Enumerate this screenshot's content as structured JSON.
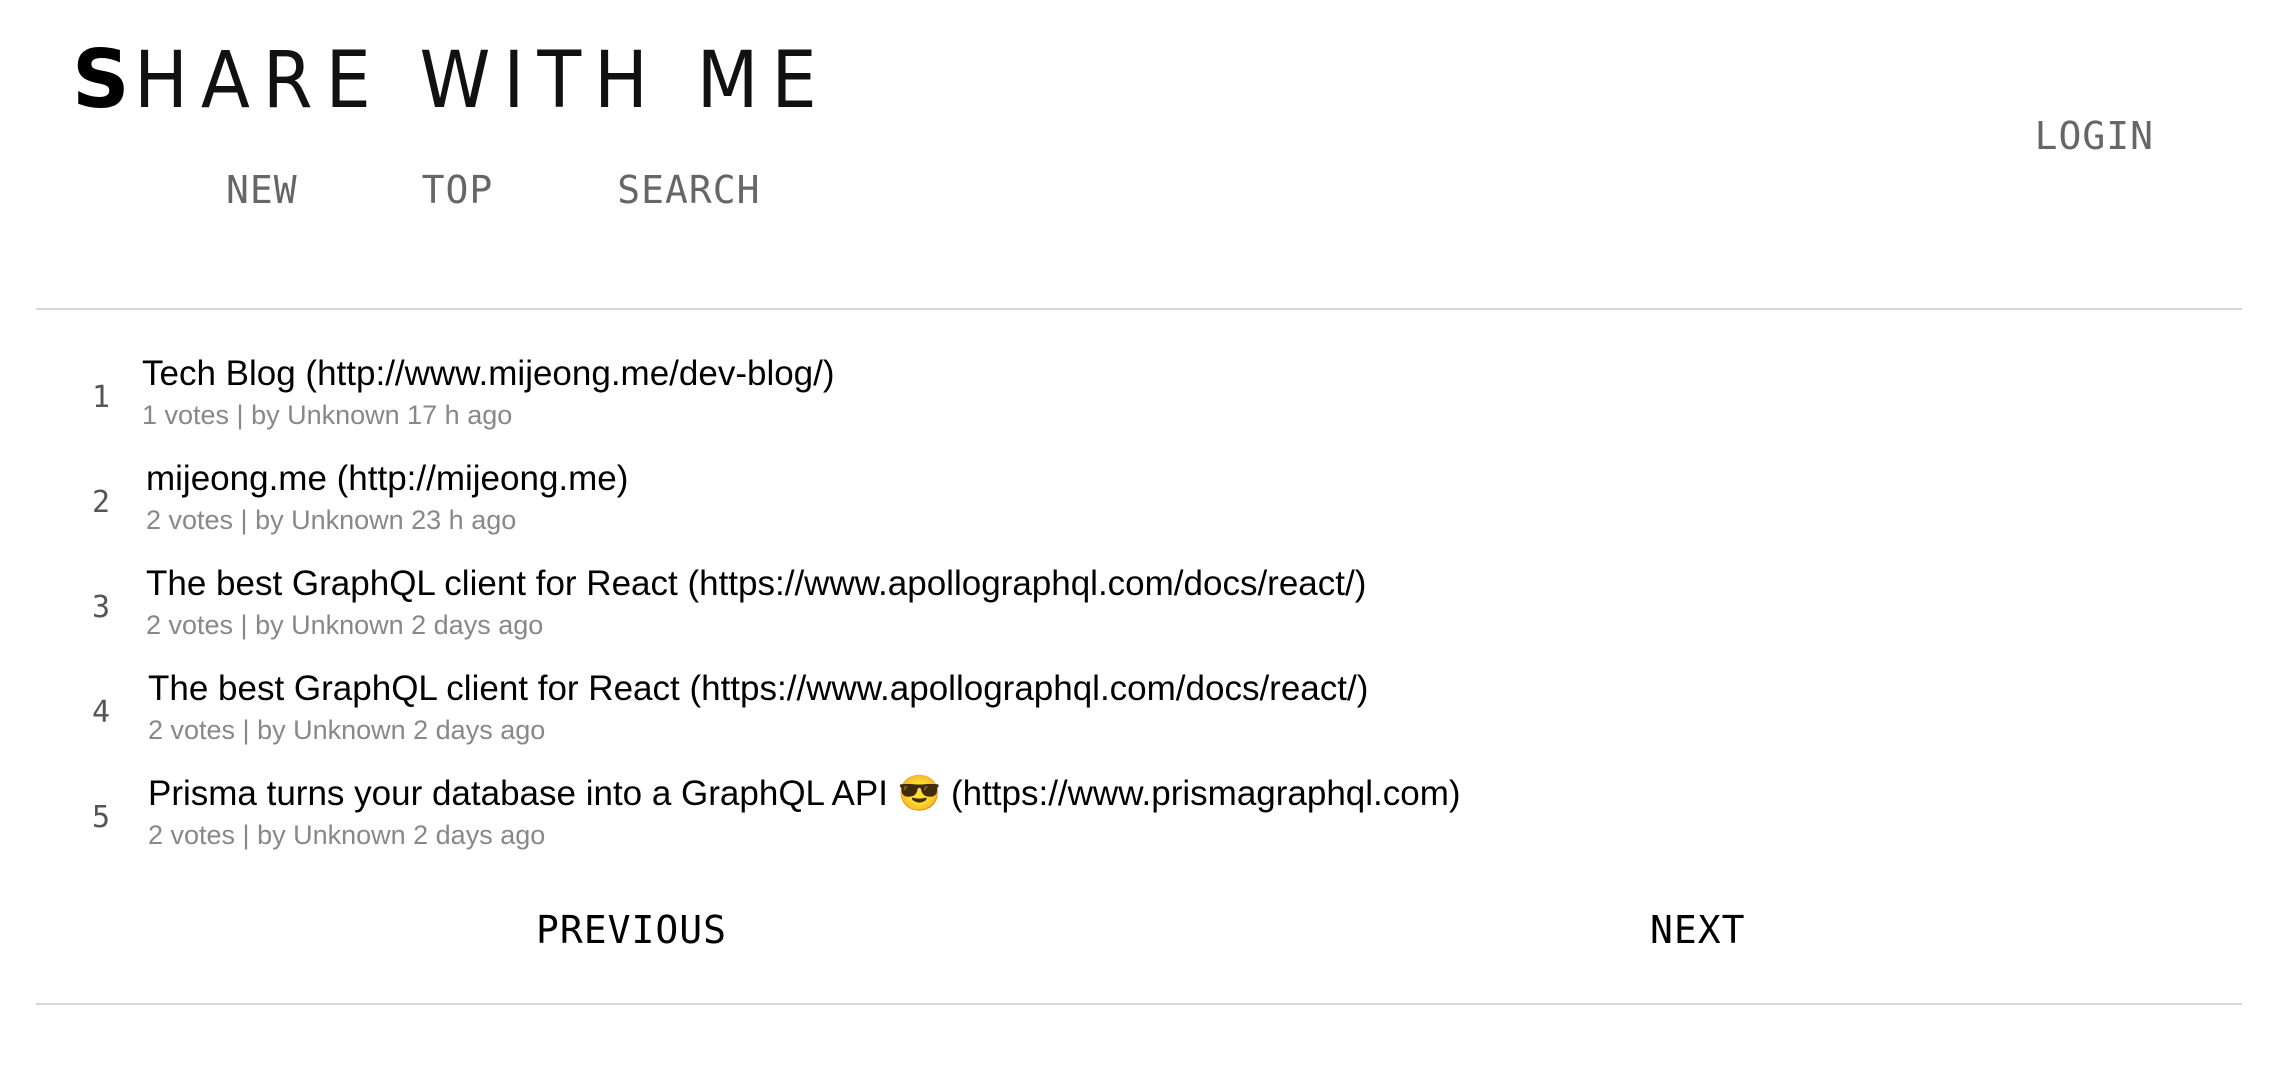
{
  "header": {
    "logo_first": "S",
    "logo_rest": "HARE WITH ME",
    "nav": [
      {
        "label": "NEW"
      },
      {
        "label": "TOP"
      },
      {
        "label": "SEARCH"
      }
    ],
    "login_label": "LOGIN"
  },
  "links": [
    {
      "rank": "1",
      "title": "Tech Blog (http://www.mijeong.me/dev-blog/)",
      "meta": "1 votes | by Unknown 17 h ago"
    },
    {
      "rank": "2",
      "title": "mijeong.me (http://mijeong.me)",
      "meta": "2 votes | by Unknown 23 h ago"
    },
    {
      "rank": "3",
      "title": "The best GraphQL client for React (https://www.apollographql.com/docs/react/)",
      "meta": "2 votes | by Unknown 2 days ago"
    },
    {
      "rank": "4",
      "title": "The best GraphQL client for React (https://www.apollographql.com/docs/react/)",
      "meta": "2 votes | by Unknown 2 days ago"
    },
    {
      "rank": "5",
      "title": "Prisma turns your database into a GraphQL API 😎 (https://www.prismagraphql.com)",
      "meta": "2 votes | by Unknown 2 days ago"
    }
  ],
  "pager": {
    "previous_label": "PREVIOUS",
    "next_label": "NEXT"
  }
}
